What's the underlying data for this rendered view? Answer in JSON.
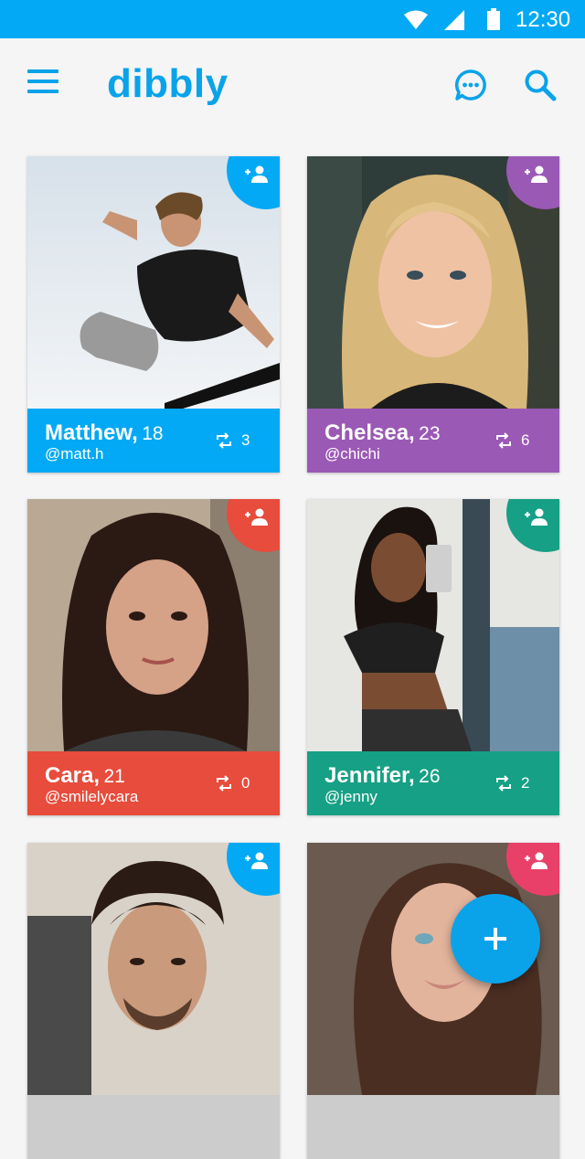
{
  "status_bar": {
    "time": "12:30",
    "icons": [
      "wifi-icon",
      "cell-signal-icon",
      "battery-icon"
    ]
  },
  "app_bar": {
    "title": "dibbly",
    "icons": [
      "menu-icon",
      "chat-icon",
      "search-icon"
    ]
  },
  "colors": {
    "primary": "#03a9f4",
    "brand_text": "#0aa3ea",
    "blue": "#03a9f4",
    "purple": "#9b59b6",
    "red": "#e74c3c",
    "teal": "#16a085",
    "pink": "#e84069"
  },
  "cards": [
    {
      "name": "Matthew,",
      "age": "18",
      "handle": "@matt.h",
      "reposts": "3",
      "color": "#03a9f4",
      "add_color": "#03a9f4"
    },
    {
      "name": "Chelsea,",
      "age": "23",
      "handle": "@chichi",
      "reposts": "6",
      "color": "#9b59b6",
      "add_color": "#9b59b6"
    },
    {
      "name": "Cara,",
      "age": "21",
      "handle": "@smilelycara",
      "reposts": "0",
      "color": "#e74c3c",
      "add_color": "#e74c3c"
    },
    {
      "name": "Jennifer,",
      "age": "26",
      "handle": "@jenny",
      "reposts": "2",
      "color": "#16a085",
      "add_color": "#16a085"
    },
    {
      "name": "",
      "age": "",
      "handle": "",
      "reposts": "",
      "color": "#03a9f4",
      "add_color": "#03a9f4"
    },
    {
      "name": "",
      "age": "",
      "handle": "",
      "reposts": "",
      "color": "#e84069",
      "add_color": "#e84069"
    }
  ],
  "fab": {
    "icon": "plus-icon"
  }
}
